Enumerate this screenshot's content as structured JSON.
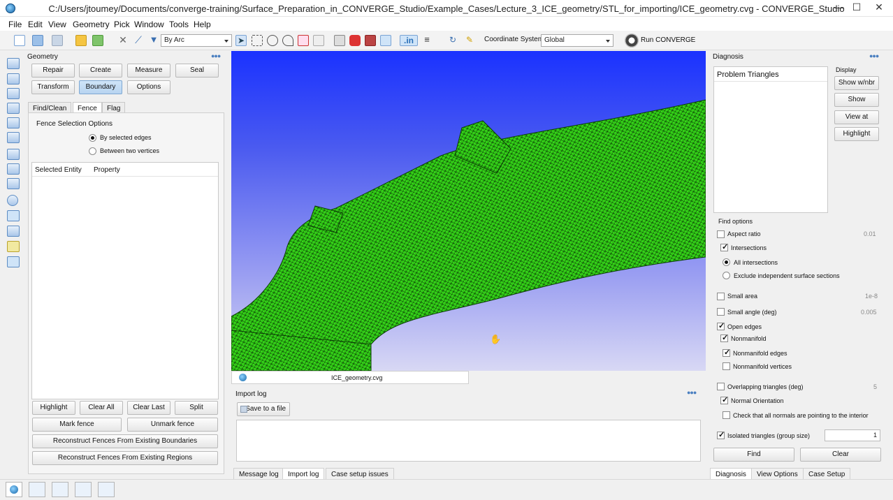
{
  "window": {
    "title": "C:/Users/jtoumey/Documents/converge-training/Surface_Preparation_in_CONVERGE_Studio/Example_Cases/Lecture_3_ICE_geometry/STL_for_importing/ICE_geometry.cvg - CONVERGE_Studio",
    "min": "—",
    "max": "☐",
    "close": "✕"
  },
  "menu": [
    "File",
    "Edit",
    "View",
    "Geometry",
    "Pick",
    "Window",
    "Tools",
    "Help"
  ],
  "toolbar": {
    "pick_mode": "By Arc",
    "coordinate_label": "Coordinate System:",
    "coordinate_value": "Global",
    "run_label": "Run CONVERGE"
  },
  "geometry_panel": {
    "title": "Geometry",
    "buttons_row1": [
      "Repair",
      "Create",
      "Measure",
      "Seal"
    ],
    "buttons_row2": [
      "Transform",
      "Boundary",
      "Options"
    ],
    "tabs": [
      "Find/Clean",
      "Fence",
      "Flag"
    ],
    "group_label": "Fence Selection Options",
    "radio1": "By selected edges",
    "radio2": "Between two vertices",
    "table_headers": [
      "Selected Entity",
      "Property"
    ],
    "action_row": [
      "Highlight",
      "Clear All",
      "Clear Last",
      "Split"
    ],
    "mark_fence": "Mark fence",
    "unmark_fence": "Unmark fence",
    "reconstruct_boundaries": "Reconstruct Fences From Existing Boundaries",
    "reconstruct_regions": "Reconstruct Fences From Existing Regions"
  },
  "viewport": {
    "file_tab": "ICE_geometry.cvg"
  },
  "log": {
    "title": "Import log",
    "save_label": "Save to a file",
    "tabs": [
      "Message log",
      "Import log",
      "Case setup issues"
    ]
  },
  "diagnosis": {
    "title": "Diagnosis",
    "list_header": "Problem Triangles",
    "display_label": "Display",
    "display_buttons": [
      "Show w/nbr",
      "Show",
      "View at",
      "Highlight"
    ],
    "find_options": "Find options",
    "aspect_ratio": "Aspect ratio",
    "aspect_ratio_value": "0.01",
    "intersections": "Intersections",
    "all_intersections": "All intersections",
    "exclude_sections": "Exclude independent surface sections",
    "small_area": "Small area",
    "small_area_value": "1e-8",
    "small_angle": "Small angle (deg)",
    "small_angle_value": "0.005",
    "open_edges": "Open edges",
    "nonmanifold": "Nonmanifold",
    "nonmanifold_edges": "Nonmanifold edges",
    "nonmanifold_vertices": "Nonmanifold vertices",
    "overlapping": "Overlapping triangles (deg)",
    "overlapping_value": "5",
    "normal_orientation": "Normal Orientation",
    "check_normals": "Check that all normals are pointing to the interior",
    "isolated": "Isolated triangles (group size)",
    "isolated_value": "1",
    "find_button": "Find",
    "clear_button": "Clear",
    "tabs": [
      "Diagnosis",
      "View Options",
      "Case Setup"
    ]
  }
}
